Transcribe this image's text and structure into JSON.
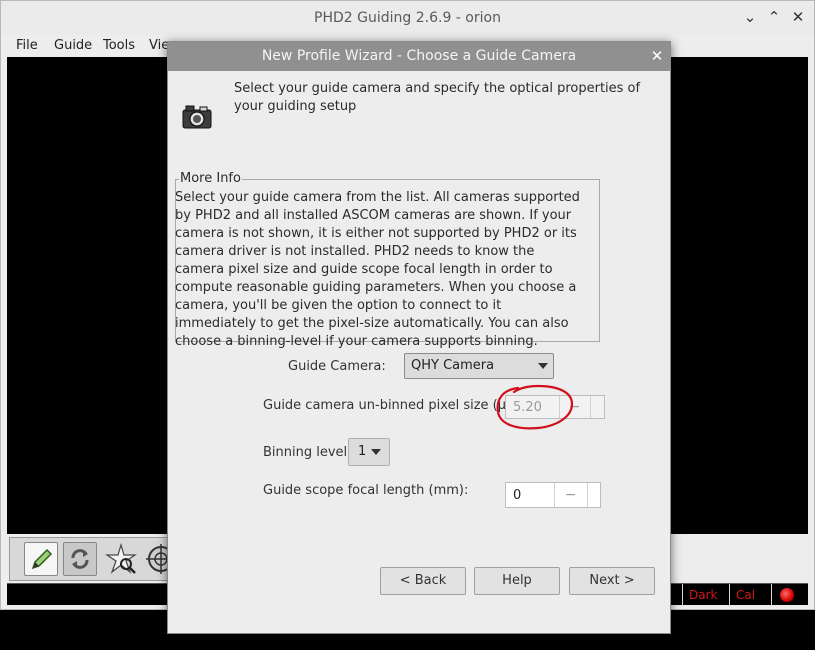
{
  "main": {
    "title": "PHD2 Guiding 2.6.9 - orion",
    "menus": [
      "File",
      "Guide",
      "Tools",
      "Vie"
    ],
    "status": {
      "dark_label": "Dark",
      "cal_label": "Cal"
    },
    "controls": {
      "minimize": "⌄",
      "maximize": "⌃",
      "close": "✕"
    }
  },
  "dialog": {
    "title": "New Profile Wizard - Choose a Guide Camera",
    "close": "✕",
    "intro": "Select your guide camera and specify the optical properties of your guiding setup",
    "more_info": {
      "label": "More Info",
      "text": "Select your guide camera from the list.  All cameras supported by PHD2 and all installed ASCOM cameras are shown. If your camera is not shown, it is either not supported by PHD2 or its camera driver is not installed.  PHD2 needs to know the camera pixel size and guide scope focal length in order to compute reasonable guiding parameters.  When you choose a camera, you'll be given the option to connect to it immediately to get the pixel-size automatically.  You can also choose a binning-level if your camera supports binning."
    },
    "guide_camera": {
      "label": "Guide Camera:",
      "value": "QHY Camera"
    },
    "pixel_size": {
      "label": "Guide camera un-binned pixel size (µm):",
      "value": "5.20",
      "minus": "−",
      "plus": "+"
    },
    "binning": {
      "label": "Binning level:",
      "value": "1"
    },
    "focal_length": {
      "label": "Guide scope focal length (mm):",
      "value": "0",
      "minus": "−",
      "plus": "+"
    },
    "buttons": {
      "back": "< Back",
      "help": "Help",
      "next": "Next >"
    }
  },
  "colors": {
    "annotation": "#d0101c",
    "status_text": "#d01818",
    "dialog_titlebar": "#909090"
  },
  "icons": [
    "camera-icon",
    "pencil-icon",
    "loop-icon",
    "star-icon",
    "crosshair-icon",
    "status-led-icon"
  ]
}
